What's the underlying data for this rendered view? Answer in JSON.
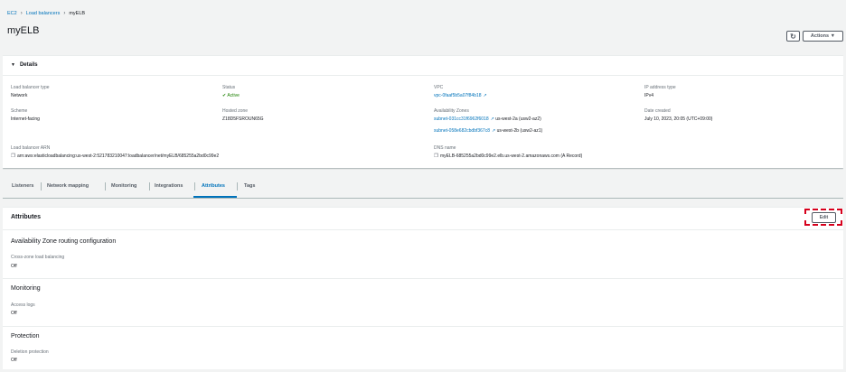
{
  "breadcrumb": {
    "items": [
      "EC2",
      "Load balancers",
      "myELB"
    ]
  },
  "page_title": "myELB",
  "header": {
    "refresh_icon": "refresh-icon",
    "actions_label": "Actions ▼"
  },
  "details": {
    "title": "Details",
    "lb_type_label": "Load balancer type",
    "lb_type_value": "Network",
    "status_label": "Status",
    "status_value": "Active",
    "vpc_label": "VPC",
    "vpc_value": "vpc-0faaf5b5a07f84b18",
    "ip_type_label": "IP address type",
    "ip_type_value": "IPv4",
    "scheme_label": "Scheme",
    "scheme_value": "Internet-facing",
    "hosted_zone_label": "Hosted zone",
    "hosted_zone_value": "Z18D5FSROUN65G",
    "az_label": "Availability Zones",
    "az_1_subnet": "subnet-031cc31f6962f6018",
    "az_1_zone": "us-west-2a (usw2-az2)",
    "az_2_subnet": "subnet-058e682cbdbf367c8",
    "az_2_zone": "us-west-2b (usw2-az1)",
    "date_label": "Date created",
    "date_value": "July 10, 2023, 20:05 (UTC+09:00)",
    "arn_label": "Load balancer ARN",
    "arn_value": "arn:aws:elasticloadbalancing:us-west-2:521783210047:loadbalancer/net/myELB/685255a2bd0c99e2",
    "dns_label": "DNS name",
    "dns_value": "myELB-685255a2bd0c99e2.elb.us-west-2.amazonaws.com (A Record)"
  },
  "tabs": [
    "Listeners",
    "Network mapping",
    "Monitoring",
    "Integrations",
    "Attributes",
    "Tags"
  ],
  "attributes": {
    "title": "Attributes",
    "edit_label": "Edit",
    "az_routing_title": "Availability Zone routing configuration",
    "cross_zone_label": "Cross-zone load balancing",
    "cross_zone_value": "Off",
    "monitoring_title": "Monitoring",
    "access_logs_label": "Access logs",
    "access_logs_value": "Off",
    "protection_title": "Protection",
    "deletion_label": "Deletion protection",
    "deletion_value": "Off"
  },
  "colors": {
    "link": "#0073bb",
    "active": "#1d8102",
    "highlight": "#d6001c"
  }
}
